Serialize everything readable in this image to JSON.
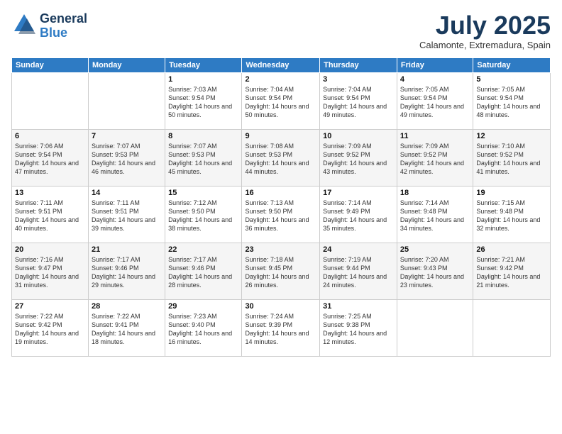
{
  "logo": {
    "general": "General",
    "blue": "Blue"
  },
  "header": {
    "month_year": "July 2025",
    "location": "Calamonte, Extremadura, Spain"
  },
  "weekdays": [
    "Sunday",
    "Monday",
    "Tuesday",
    "Wednesday",
    "Thursday",
    "Friday",
    "Saturday"
  ],
  "weeks": [
    [
      {
        "day": "",
        "info": ""
      },
      {
        "day": "",
        "info": ""
      },
      {
        "day": "1",
        "info": "Sunrise: 7:03 AM\nSunset: 9:54 PM\nDaylight: 14 hours and 50 minutes."
      },
      {
        "day": "2",
        "info": "Sunrise: 7:04 AM\nSunset: 9:54 PM\nDaylight: 14 hours and 50 minutes."
      },
      {
        "day": "3",
        "info": "Sunrise: 7:04 AM\nSunset: 9:54 PM\nDaylight: 14 hours and 49 minutes."
      },
      {
        "day": "4",
        "info": "Sunrise: 7:05 AM\nSunset: 9:54 PM\nDaylight: 14 hours and 49 minutes."
      },
      {
        "day": "5",
        "info": "Sunrise: 7:05 AM\nSunset: 9:54 PM\nDaylight: 14 hours and 48 minutes."
      }
    ],
    [
      {
        "day": "6",
        "info": "Sunrise: 7:06 AM\nSunset: 9:54 PM\nDaylight: 14 hours and 47 minutes."
      },
      {
        "day": "7",
        "info": "Sunrise: 7:07 AM\nSunset: 9:53 PM\nDaylight: 14 hours and 46 minutes."
      },
      {
        "day": "8",
        "info": "Sunrise: 7:07 AM\nSunset: 9:53 PM\nDaylight: 14 hours and 45 minutes."
      },
      {
        "day": "9",
        "info": "Sunrise: 7:08 AM\nSunset: 9:53 PM\nDaylight: 14 hours and 44 minutes."
      },
      {
        "day": "10",
        "info": "Sunrise: 7:09 AM\nSunset: 9:52 PM\nDaylight: 14 hours and 43 minutes."
      },
      {
        "day": "11",
        "info": "Sunrise: 7:09 AM\nSunset: 9:52 PM\nDaylight: 14 hours and 42 minutes."
      },
      {
        "day": "12",
        "info": "Sunrise: 7:10 AM\nSunset: 9:52 PM\nDaylight: 14 hours and 41 minutes."
      }
    ],
    [
      {
        "day": "13",
        "info": "Sunrise: 7:11 AM\nSunset: 9:51 PM\nDaylight: 14 hours and 40 minutes."
      },
      {
        "day": "14",
        "info": "Sunrise: 7:11 AM\nSunset: 9:51 PM\nDaylight: 14 hours and 39 minutes."
      },
      {
        "day": "15",
        "info": "Sunrise: 7:12 AM\nSunset: 9:50 PM\nDaylight: 14 hours and 38 minutes."
      },
      {
        "day": "16",
        "info": "Sunrise: 7:13 AM\nSunset: 9:50 PM\nDaylight: 14 hours and 36 minutes."
      },
      {
        "day": "17",
        "info": "Sunrise: 7:14 AM\nSunset: 9:49 PM\nDaylight: 14 hours and 35 minutes."
      },
      {
        "day": "18",
        "info": "Sunrise: 7:14 AM\nSunset: 9:48 PM\nDaylight: 14 hours and 34 minutes."
      },
      {
        "day": "19",
        "info": "Sunrise: 7:15 AM\nSunset: 9:48 PM\nDaylight: 14 hours and 32 minutes."
      }
    ],
    [
      {
        "day": "20",
        "info": "Sunrise: 7:16 AM\nSunset: 9:47 PM\nDaylight: 14 hours and 31 minutes."
      },
      {
        "day": "21",
        "info": "Sunrise: 7:17 AM\nSunset: 9:46 PM\nDaylight: 14 hours and 29 minutes."
      },
      {
        "day": "22",
        "info": "Sunrise: 7:17 AM\nSunset: 9:46 PM\nDaylight: 14 hours and 28 minutes."
      },
      {
        "day": "23",
        "info": "Sunrise: 7:18 AM\nSunset: 9:45 PM\nDaylight: 14 hours and 26 minutes."
      },
      {
        "day": "24",
        "info": "Sunrise: 7:19 AM\nSunset: 9:44 PM\nDaylight: 14 hours and 24 minutes."
      },
      {
        "day": "25",
        "info": "Sunrise: 7:20 AM\nSunset: 9:43 PM\nDaylight: 14 hours and 23 minutes."
      },
      {
        "day": "26",
        "info": "Sunrise: 7:21 AM\nSunset: 9:42 PM\nDaylight: 14 hours and 21 minutes."
      }
    ],
    [
      {
        "day": "27",
        "info": "Sunrise: 7:22 AM\nSunset: 9:42 PM\nDaylight: 14 hours and 19 minutes."
      },
      {
        "day": "28",
        "info": "Sunrise: 7:22 AM\nSunset: 9:41 PM\nDaylight: 14 hours and 18 minutes."
      },
      {
        "day": "29",
        "info": "Sunrise: 7:23 AM\nSunset: 9:40 PM\nDaylight: 14 hours and 16 minutes."
      },
      {
        "day": "30",
        "info": "Sunrise: 7:24 AM\nSunset: 9:39 PM\nDaylight: 14 hours and 14 minutes."
      },
      {
        "day": "31",
        "info": "Sunrise: 7:25 AM\nSunset: 9:38 PM\nDaylight: 14 hours and 12 minutes."
      },
      {
        "day": "",
        "info": ""
      },
      {
        "day": "",
        "info": ""
      }
    ]
  ]
}
